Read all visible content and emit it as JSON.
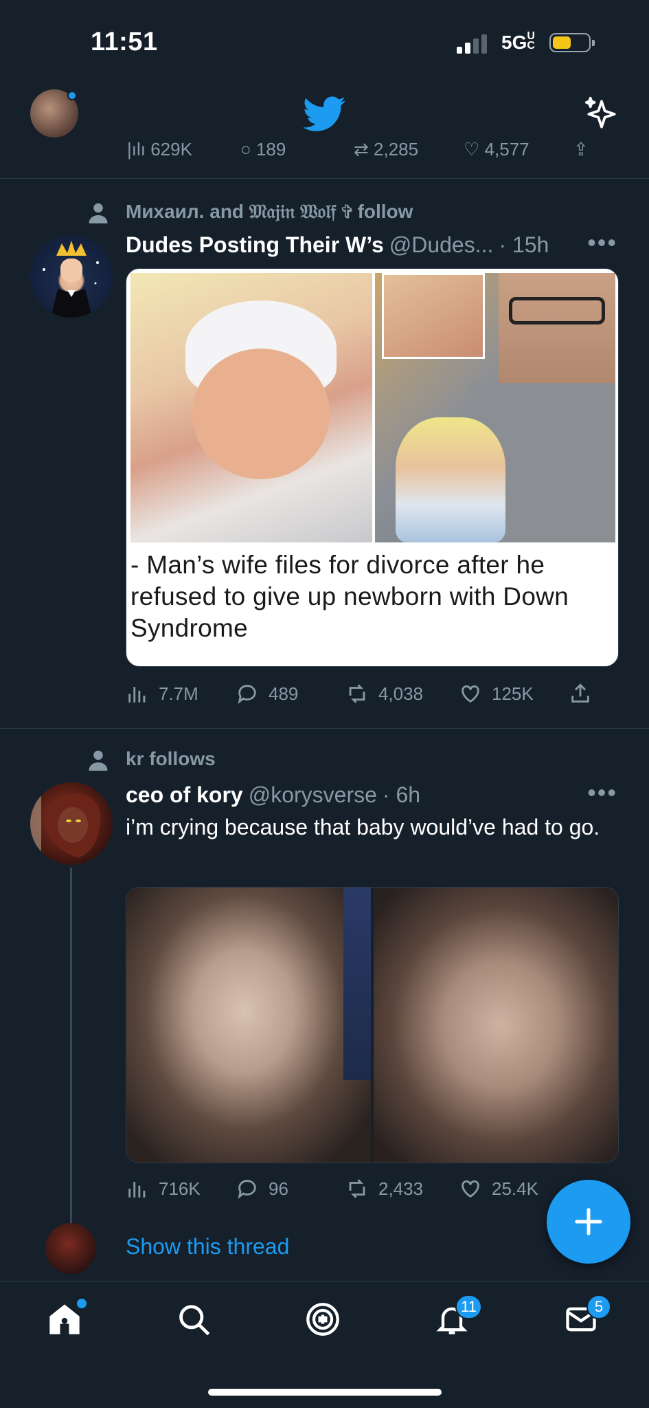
{
  "status_bar": {
    "time": "11:51",
    "network": "5GUC",
    "battery_level": 0.35,
    "battery_color": "#f5c518"
  },
  "top_nav": {
    "logo_icon": "twitter-bird-icon",
    "right_icon": "sparkle-icon",
    "peek_stats": {
      "views": "629K",
      "replies": "189",
      "retweets": "2,285",
      "likes": "4,577"
    }
  },
  "tweets": [
    {
      "context": "Михаил. and 𝔐𝔞𝔧𝔦𝔫 𝔚𝔬𝔩𝔣 ✞ follow",
      "name": "Dudes Posting Their W’s",
      "handle": "@Dudes...",
      "time": "· 15h",
      "media_caption": "- Man’s wife files for divorce after he refused to give up newborn with Down Syndrome",
      "stats": {
        "views": "7.7M",
        "replies": "489",
        "retweets": "4,038",
        "likes": "125K"
      }
    },
    {
      "context": "kr follows",
      "name": "ceo of kory",
      "handle": "@korysverse",
      "time": "· 6h",
      "text": "i’m crying because that baby would’ve had to go.",
      "stats": {
        "views": "716K",
        "replies": "96",
        "retweets": "2,433",
        "likes": "25.4K"
      },
      "show_thread": "Show this thread"
    }
  ],
  "bottom_nav": {
    "items": [
      "home-icon",
      "search-icon",
      "spaces-icon",
      "notifications-icon",
      "messages-icon"
    ],
    "notifications_badge": "11",
    "messages_badge": "5"
  },
  "colors": {
    "background": "#15202b",
    "accent": "#1d9bf0",
    "secondary_text": "#8899a6",
    "divider": "#2f3b47"
  }
}
